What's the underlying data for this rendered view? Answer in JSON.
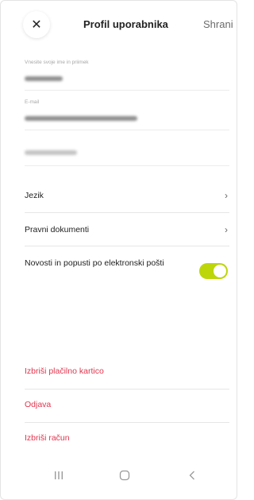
{
  "header": {
    "title": "Profil uporabnika",
    "save_label": "Shrani",
    "close_icon": "close-icon"
  },
  "fields": {
    "name_label": "Vnesite svoje ime in priimek",
    "email_label": "E-mail"
  },
  "menu": {
    "language_label": "Jezik",
    "legal_label": "Pravni dokumenti",
    "newsletter_label": "Novosti in popusti po elektronski pošti",
    "newsletter_enabled": true
  },
  "actions": {
    "delete_card_label": "Izbriši plačilno kartico",
    "logout_label": "Odjava",
    "delete_account_label": "Izbriši račun"
  },
  "colors": {
    "accent": "#bcd60a",
    "danger": "#e0364e"
  },
  "nav": {
    "recent_icon": "recent-apps-icon",
    "home_icon": "home-icon",
    "back_icon": "back-icon"
  }
}
